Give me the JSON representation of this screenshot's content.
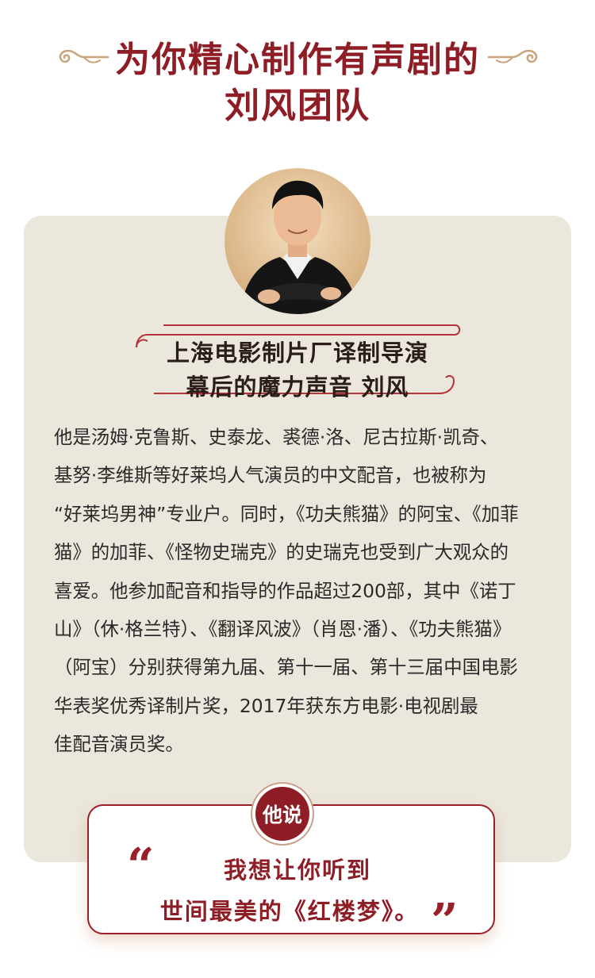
{
  "header": {
    "title_line1": "为你精心制作有声剧的",
    "title_line2": "刘风团队"
  },
  "profile": {
    "name_line1": "上海电影制片厂译制导演",
    "name_line2": "幕后的魔力声音 刘风"
  },
  "bio": {
    "lines": [
      "他是汤姆·克鲁斯、史泰龙、裘德·洛、尼古拉斯·凯奇、",
      "基努·李维斯等好莱坞人气演员的中文配音，也被称为",
      "“好莱坞男神”专业户。同时，《功夫熊猫》的阿宝、《加菲",
      "猫》的加菲、《怪物史瑞克》的史瑞克也受到广大观众的",
      "喜爱。他参加配音和指导的作品超过200部，其中《诺丁",
      "山》（休·格兰特）、《翻译风波》（肖恩·潘）、《功夫熊猫》",
      "（阿宝）分别获得第九届、第十一届、第十三届中国电影",
      "华表奖优秀译制片奖，2017年获东方电影·电视剧最",
      "佳配音演员奖。"
    ]
  },
  "quote": {
    "badge": "他说",
    "line1": "我想让你听到",
    "line2": "世间最美的《红楼梦》。",
    "open_mark": "“",
    "close_mark": "”"
  },
  "colors": {
    "accent": "#8f1d25",
    "card_bg": "#ebe7dc",
    "gold": "#c9a27a"
  }
}
